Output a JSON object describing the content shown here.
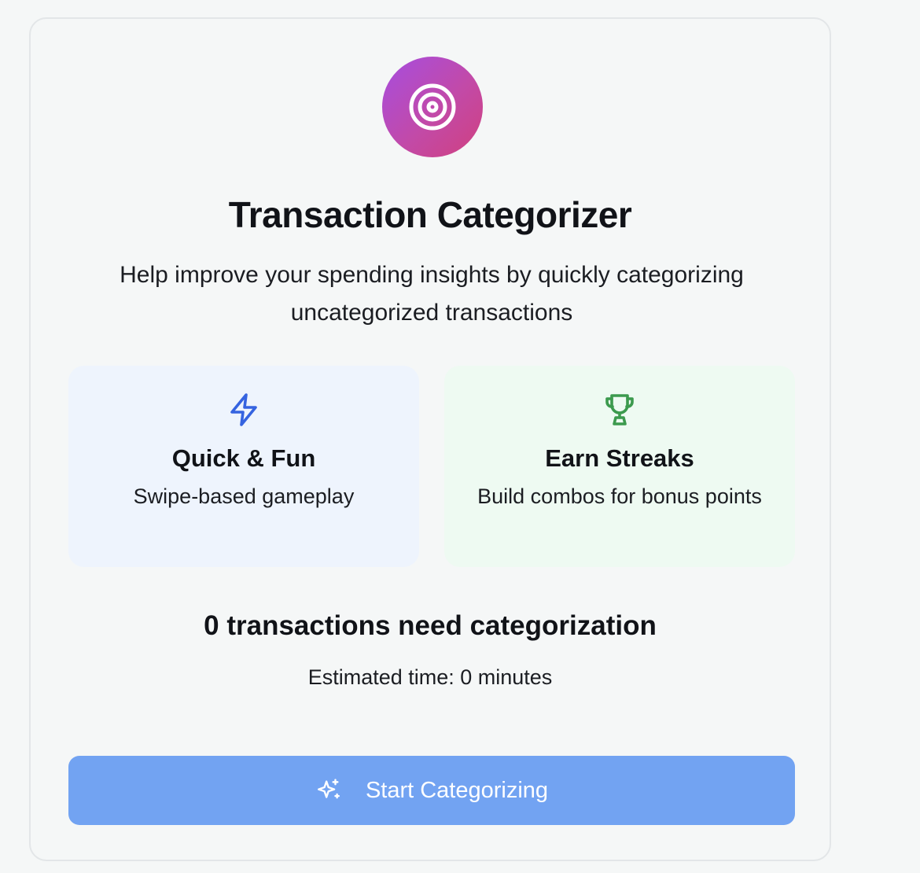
{
  "hero": {
    "icon": "target-icon",
    "title": "Transaction Categorizer",
    "subtitle": "Help improve your spending insights by quickly categorizing uncategorized transactions"
  },
  "features": [
    {
      "icon": "lightning-icon",
      "title": "Quick & Fun",
      "description": "Swipe-based gameplay",
      "color": "#3563e0",
      "background": "#eef4fd"
    },
    {
      "icon": "trophy-icon",
      "title": "Earn Streaks",
      "description": "Build combos for bonus points",
      "color": "#3c9a4e",
      "background": "#eefaf2"
    }
  ],
  "status": {
    "count_text": "0 transactions need categorization",
    "estimate_text": "Estimated time: 0 minutes"
  },
  "action": {
    "icon": "sparkles-icon",
    "label": "Start Categorizing",
    "color": "#72a3f2"
  },
  "colors": {
    "hero_gradient_start": "#a64de0",
    "hero_gradient_end": "#d0407f",
    "page_background": "#f5f7f7"
  }
}
